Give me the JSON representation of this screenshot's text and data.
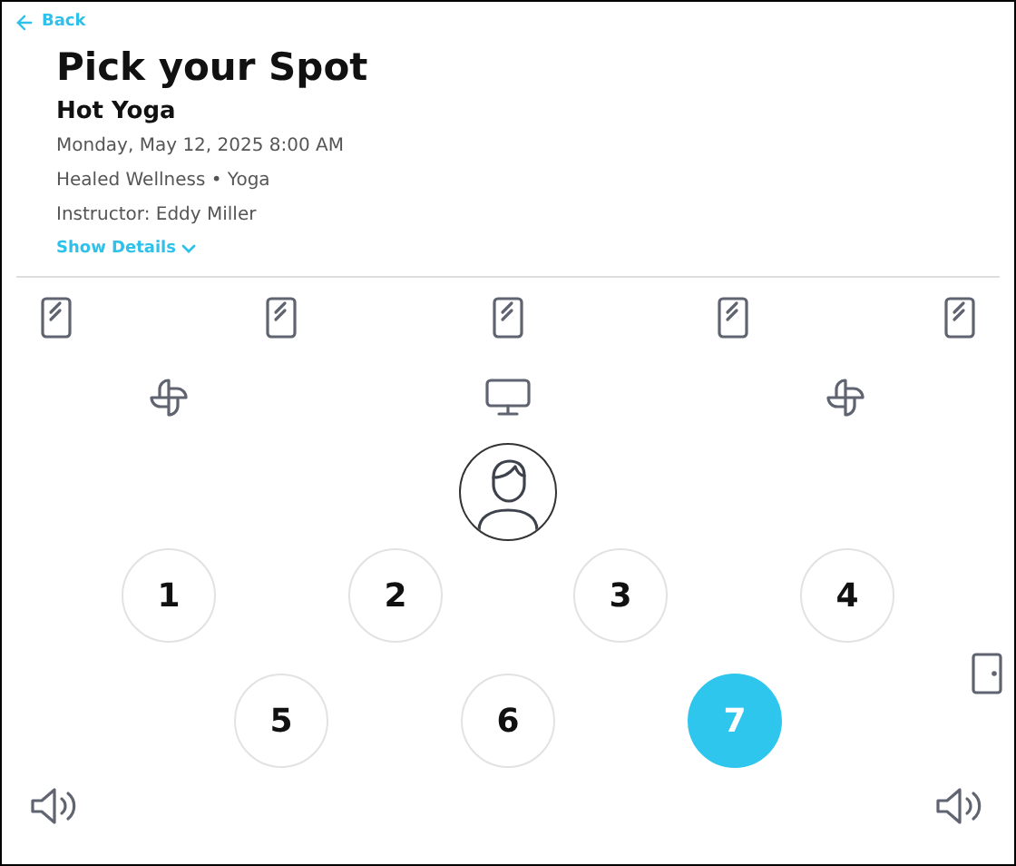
{
  "back": "Back",
  "title": "Pick your Spot",
  "class_name": "Hot Yoga",
  "date": "Monday, May 12, 2025 8:00 AM",
  "location": "Healed Wellness • Yoga",
  "instructor": "Instructor: Eddy Miller",
  "show_details": "Show Details",
  "spots": [
    {
      "label": "1",
      "selected": false
    },
    {
      "label": "2",
      "selected": false
    },
    {
      "label": "3",
      "selected": false
    },
    {
      "label": "4",
      "selected": false
    },
    {
      "label": "5",
      "selected": false
    },
    {
      "label": "6",
      "selected": false
    },
    {
      "label": "7",
      "selected": true
    }
  ]
}
